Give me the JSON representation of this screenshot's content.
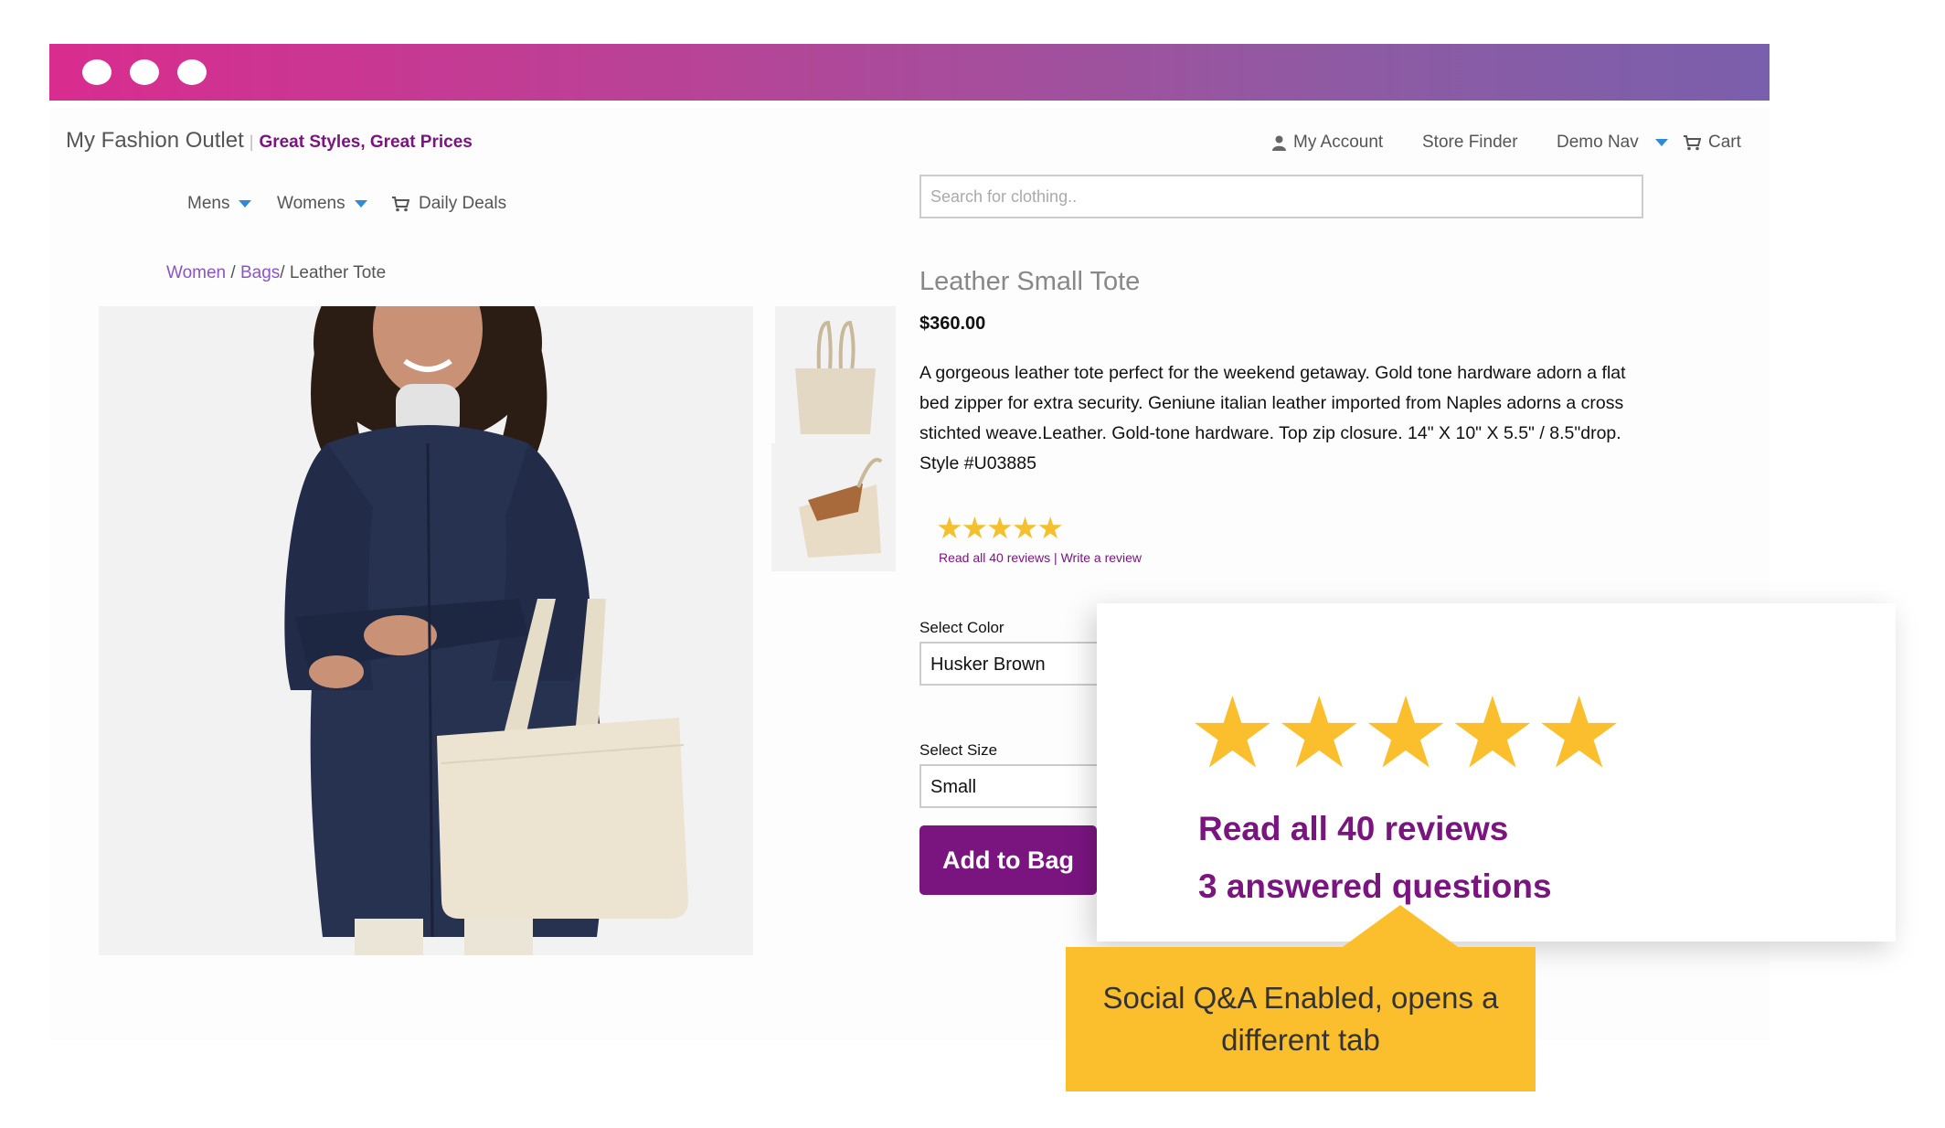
{
  "brand": {
    "name": "My Fashion Outlet",
    "separator": "|",
    "tagline": "Great Styles, Great Prices"
  },
  "topnav": {
    "account": "My Account",
    "store_finder": "Store Finder",
    "demo_nav": "Demo Nav",
    "cart": "Cart"
  },
  "mainnav": {
    "mens": "Mens",
    "womens": "Womens",
    "deals": "Daily Deals"
  },
  "search": {
    "placeholder": "Search for clothing.."
  },
  "breadcrumb": {
    "women": "Women",
    "sep1": " / ",
    "bags": "Bags",
    "sep2": "/ ",
    "current": "Leather Tote"
  },
  "product": {
    "title": "Leather Small Tote",
    "price": "$360.00",
    "description": "A gorgeous leather tote perfect for the weekend getaway. Gold tone hardware adorn a flat bed zipper for extra security. Geniune italian leather imported from Naples adorns a cross stichted weave.Leather. Gold-tone hardware. Top zip closure. 14\" X 10\" X 5.5\" / 8.5\"drop. Style #U03885",
    "rating": 4.5,
    "small_stars": "★★★★★",
    "read_reviews": "Read all 40 reviews",
    "review_sep": " | ",
    "write_review": "Write a review",
    "color_label": "Select Color",
    "color_value": "Husker Brown",
    "size_label": "Select Size",
    "size_value": "Small",
    "add_to_bag": "Add to Bag"
  },
  "popup": {
    "stars": "★★★★★",
    "read_reviews": "Read all 40 reviews",
    "answered": "3 answered questions"
  },
  "callout": {
    "text": "Social Q&A Enabled, opens a different tab"
  },
  "colors": {
    "brand_purple": "#7a1580",
    "star_yellow": "#fbbf2d",
    "link_purple": "#8a55c4",
    "caret_blue": "#2f8ad8"
  },
  "icons": [
    "user-icon",
    "cart-icon",
    "star-icon",
    "caret-down-icon"
  ]
}
